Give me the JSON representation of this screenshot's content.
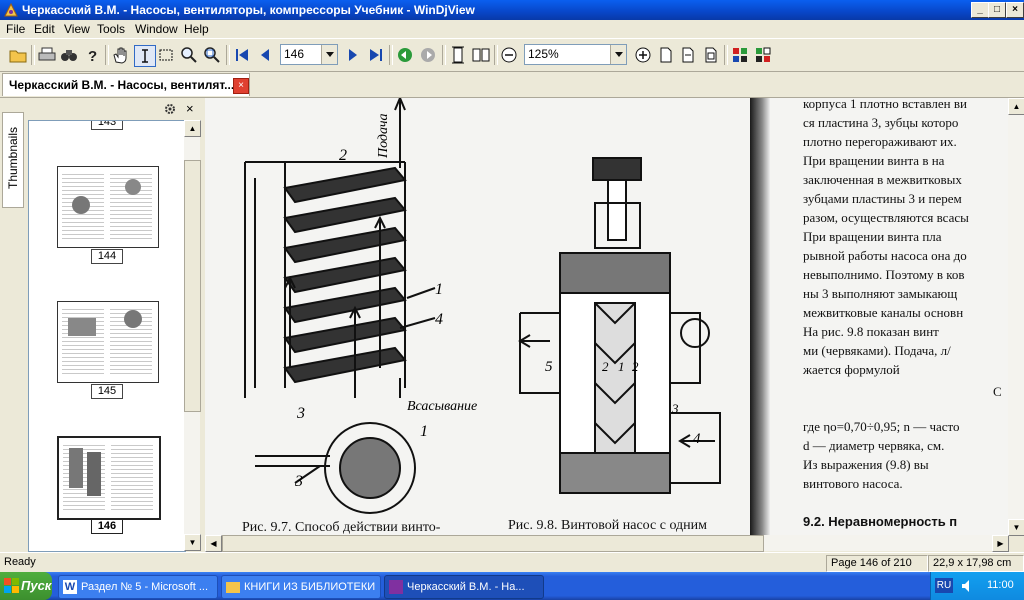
{
  "window": {
    "title": "Черкасский В.М. - Насосы, вентиляторы, компрессоры Учебник - WinDjView",
    "minimize": "_",
    "maximize": "□",
    "close": "×"
  },
  "menu": [
    "File",
    "Edit",
    "View",
    "Tools",
    "Window",
    "Help"
  ],
  "toolbar": {
    "page_value": "146",
    "zoom_value": "125%"
  },
  "tab": {
    "label": "Черкасский В.М. - Насосы, вентилят...",
    "close": "×"
  },
  "sidebar": {
    "tab_label": "Thumbnails",
    "thumbnails": [
      {
        "label": "143"
      },
      {
        "label": "144"
      },
      {
        "label": "145"
      },
      {
        "label": "146"
      }
    ]
  },
  "document": {
    "right_lines": [
      "корпуса 1 плотно вставлен ви",
      "ся пластина 3, зубцы которо",
      "плотно перегораживают их.",
      "    При вращении винта в на",
      "заключенная в межвитковых",
      "зубцами пластины 3 и перем",
      "разом, осуществляются всасы",
      "    При вращении винта пла",
      "рывной работы насоса она до",
      "невыполнимо. Поэтому в ков",
      "ны 3 выполняют замыкающ",
      "межвитковые каналы основн",
      "    На рис. 9.8 показан винт",
      "ми (червяками). Подача, л/",
      "жается формулой",
      "где ηо=0,70÷0,95; n — часто",
      "d — диаметр червяка, см.",
      "    Из выражения (9.8) вы",
      "винтового насоса.",
      "9.2. Неравномерность п"
    ],
    "formula_mark": "С",
    "caption_left": "Рис. 9.7. Способ действии винто-",
    "caption_right": "Рис. 9.8. Винтовой насос с одним",
    "fig_labels": {
      "podacha": "Подача",
      "vsas": "Всасывание",
      "n1": "1",
      "n2": "2",
      "n3": "3",
      "n4": "4",
      "n5": "5",
      "c1": "1",
      "c3": "3",
      "r2a": "2",
      "r1": "1",
      "r2b": "2",
      "r3": "3",
      "r4": "4"
    }
  },
  "status": {
    "ready": "Ready",
    "page": "Page 146 of 210",
    "size": "22,9 x 17,98 cm"
  },
  "taskbar": {
    "start": "Пуск",
    "tasks": [
      "Раздел № 5 - Microsoft ...",
      "КНИГИ ИЗ БИБЛИОТЕКИ",
      "Черкасский В.М. - На..."
    ],
    "lang": "RU",
    "clock": "11:00"
  },
  "colors": {
    "titlebar": "#0846c8",
    "taskbar": "#245edb",
    "start": "#3c8f2e"
  }
}
